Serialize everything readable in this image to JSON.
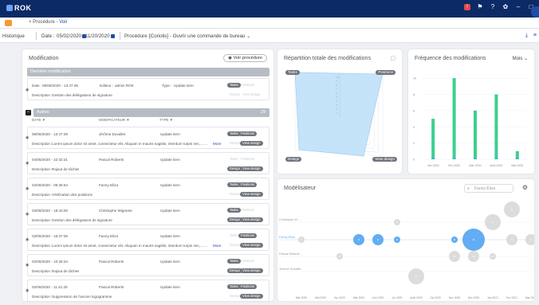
{
  "app": {
    "logo": "ROK"
  },
  "topbar": {
    "icons": [
      "alert-icon",
      "flag-icon",
      "help-icon",
      "settings-icon",
      "minimize-icon",
      "maximize-icon"
    ]
  },
  "tabs": {
    "breadcrumb_prefix": "Procédure - ",
    "breadcrumb_current": "Voir"
  },
  "filter": {
    "historique": "Historique",
    "date_label": "Date :",
    "date_from": "05/02/2020",
    "date_to": "11/20/2020",
    "procedure_label": "Procédure :",
    "procedure_value": "[Coriolis] - Ouvrir une commande de bureau",
    "procedure_caret": "⌄"
  },
  "modification": {
    "title": "Modification",
    "voir_label": "Voir procédure",
    "derniere": "Dernière modification",
    "last": {
      "date_label": "Date :",
      "date_value": "08/08/2020 - 13:47:39",
      "editeur_label": "Editeur :",
      "editeur_value": "admin ROK",
      "type_label": "Type :",
      "type_value": "Update item",
      "desc_label": "Description :",
      "desc_value": "Gestion des délégations de signature",
      "pills": [
        "Tasks",
        "Positions",
        "Design",
        "View design"
      ]
    },
    "autres": "Autres",
    "autres_count": "29",
    "columns": [
      "DATE ▼",
      "MODIFICATEUR ▼",
      "TYPE ▼"
    ],
    "desc_label": "Description :",
    "more": "More",
    "rows": [
      {
        "date": "05/08/2020 - 13:47:39",
        "user": "Jérôme Duvallet",
        "type": "Update item",
        "desc": "Lorem ipsum dolor sit amet, consectetur elit. Aliquam in mauris sagittis, interdum turpis nec,.......",
        "has_more": true
      },
      {
        "date": "04/08/2020 - 22:32:21",
        "user": "Pascal Roberts",
        "type": "Update item",
        "desc": "Rajout de tâches",
        "has_more": false
      },
      {
        "date": "04/08/2020 - 09:36:54",
        "user": "Fanny Eliza",
        "type": "Update item",
        "desc": "Vérification des positions",
        "has_more": false
      },
      {
        "date": "03/08/2020 - 18:43:00",
        "user": "Christophe Wigrante",
        "type": "Update item",
        "desc": "Gestion des délégations de signature",
        "has_more": false
      },
      {
        "date": "03/08/2020 - 16:37:36",
        "user": "Fanny Eliza",
        "type": "Update item",
        "desc": "Lorem ipsum dolor sit amet, consectetur elit. Aliquam in mauris sagittis, interdum turpis nec,.......",
        "has_more": true
      },
      {
        "date": "02/08/2020 - 10:28:34",
        "user": "Pascal Roberts",
        "type": "Update item",
        "desc": "Rajout de tâches",
        "has_more": false
      },
      {
        "date": "02/08/2020 - 11:41:29",
        "user": "Pascal Roberts",
        "type": "Update item",
        "desc": "Suppression de l'ancien logogramme",
        "has_more": false
      }
    ],
    "pill_labels": [
      "Tasks",
      "Positions",
      "Design",
      "View design"
    ]
  },
  "repartition": {
    "title": "Répartition totale des modifications",
    "labels": [
      "Tasks",
      "Positions",
      "Design",
      "View design"
    ],
    "scale": [
      "10",
      "9",
      "8",
      "7",
      "6",
      "5",
      "4",
      "3",
      "2",
      "1"
    ]
  },
  "frequence": {
    "title": "Fréquence des modifications",
    "period": "Mois",
    "period_caret": "⌄"
  },
  "modelisateur": {
    "title": "Modélisateur",
    "search_placeholder": "Fanny Eliza",
    "rows": [
      "Christophe W...",
      "Fanny Eliza",
      "Pascal Roberts",
      "Jérôme Duvallet"
    ],
    "months": [
      "Mar 2020",
      "Mai 2020",
      "Avr 2020",
      "Mar 2020",
      "Juin 2020",
      "Jui 2020",
      "Août 2020",
      "Oct 2020",
      "Nov 2020",
      "Déc 2020",
      "Jan 2021",
      "Fev 2021",
      "Mar 2021"
    ]
  },
  "chart_data": [
    {
      "type": "bar",
      "categories": [
        "Jan 2020",
        "Fev 2020",
        "Mar 2020",
        "Avril 2020",
        "Mai 2020"
      ],
      "series": [
        {
          "values": [
            5,
            10,
            6,
            8,
            1
          ]
        }
      ],
      "ytick_labels": [
        "0",
        "2",
        "4",
        "6",
        "8",
        "10"
      ],
      "ylim": [
        0,
        11
      ],
      "grid": true,
      "colors": {
        "bar": "#3ccf8e",
        "base": "#4aa3ee"
      }
    },
    {
      "type": "scatter",
      "x": [
        1,
        4,
        5,
        6,
        9,
        10,
        10,
        11,
        12,
        13,
        6,
        3,
        7,
        9,
        11,
        12
      ],
      "y": [
        2,
        2,
        2,
        2,
        2,
        2,
        1,
        3,
        2,
        2,
        3,
        1,
        0,
        1,
        1,
        4
      ],
      "sizes": [
        1,
        2,
        2,
        1,
        1,
        4,
        2,
        3,
        2,
        2,
        1,
        1,
        3,
        2,
        1,
        3
      ],
      "colors": {
        "highlight": "#5aa9f2",
        "default": "#d8d8d8"
      }
    }
  ]
}
